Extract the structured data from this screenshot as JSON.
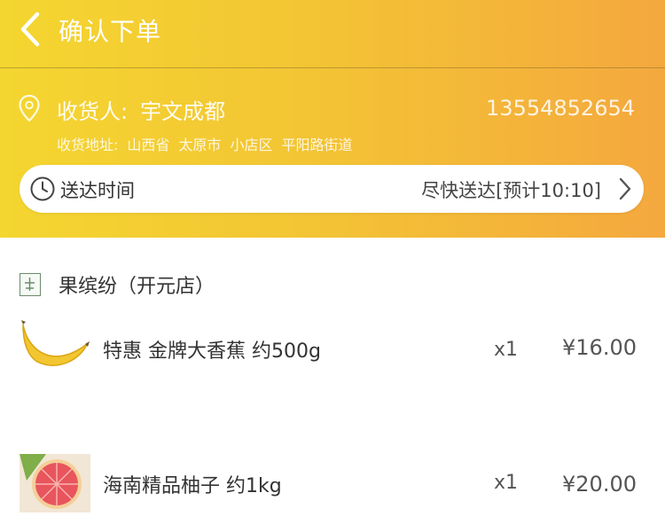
{
  "navbar": {
    "title": "确认下单"
  },
  "receiver": {
    "label": "收货人:",
    "name": "宇文成都",
    "phone": "13554852654"
  },
  "address": {
    "label": "收货地址:",
    "province": "山西省",
    "city": "太原市",
    "district": "小店区",
    "street": "平阳路街道"
  },
  "delivery": {
    "label": "送达时间",
    "value": "尽快送达[预计10:10]"
  },
  "store": {
    "name": "果缤纷（开元店）"
  },
  "items": [
    {
      "name": "特惠 金牌大香蕉 约500g",
      "qty": "x1",
      "price": "¥16.00",
      "icon": "banana-icon"
    },
    {
      "name": "海南精品柚子 约1kg",
      "qty": "x1",
      "price": "¥20.00",
      "icon": "grapefruit-icon"
    }
  ],
  "colors": {
    "header_start": "#f4d630",
    "header_end": "#f4a83e"
  }
}
